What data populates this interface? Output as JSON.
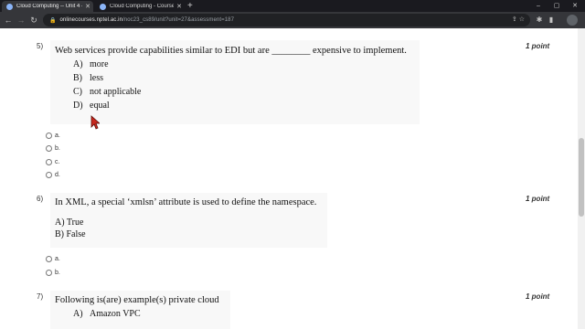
{
  "browser": {
    "tabs": [
      {
        "title": "Cloud Computing -- Unit 4 - We",
        "active": true
      },
      {
        "title": "Cloud Computing - Course",
        "active": false
      }
    ],
    "new_tab": "+",
    "window_controls": [
      "–",
      "▢",
      "✕"
    ],
    "url_host": "onlinecourses.nptel.ac.in",
    "url_path": "/noc23_cs89/unit?unit=27&assessment=187",
    "accent": "#8ab4f8"
  },
  "questions": [
    {
      "number": "5)",
      "points": "1 point",
      "text": "Web services provide capabilities similar to EDI but are ________ expensive to implement.",
      "options": [
        {
          "letter": "A)",
          "text": "more"
        },
        {
          "letter": "B)",
          "text": "less"
        },
        {
          "letter": "C)",
          "text": "not applicable"
        },
        {
          "letter": "D)",
          "text": "equal"
        }
      ],
      "choices": [
        "a.",
        "b.",
        "c.",
        "d."
      ]
    },
    {
      "number": "6)",
      "points": "1 point",
      "text": "In XML, a special ‘xmlsn’ attribute is used to define the namespace.",
      "lines": [
        "A) True",
        "B) False"
      ],
      "choices": [
        "a.",
        "b."
      ]
    },
    {
      "number": "7)",
      "points": "1 point",
      "text": "Following is(are) example(s) private cloud",
      "options": [
        {
          "letter": "A)",
          "text": "Amazon VPC"
        }
      ]
    }
  ]
}
